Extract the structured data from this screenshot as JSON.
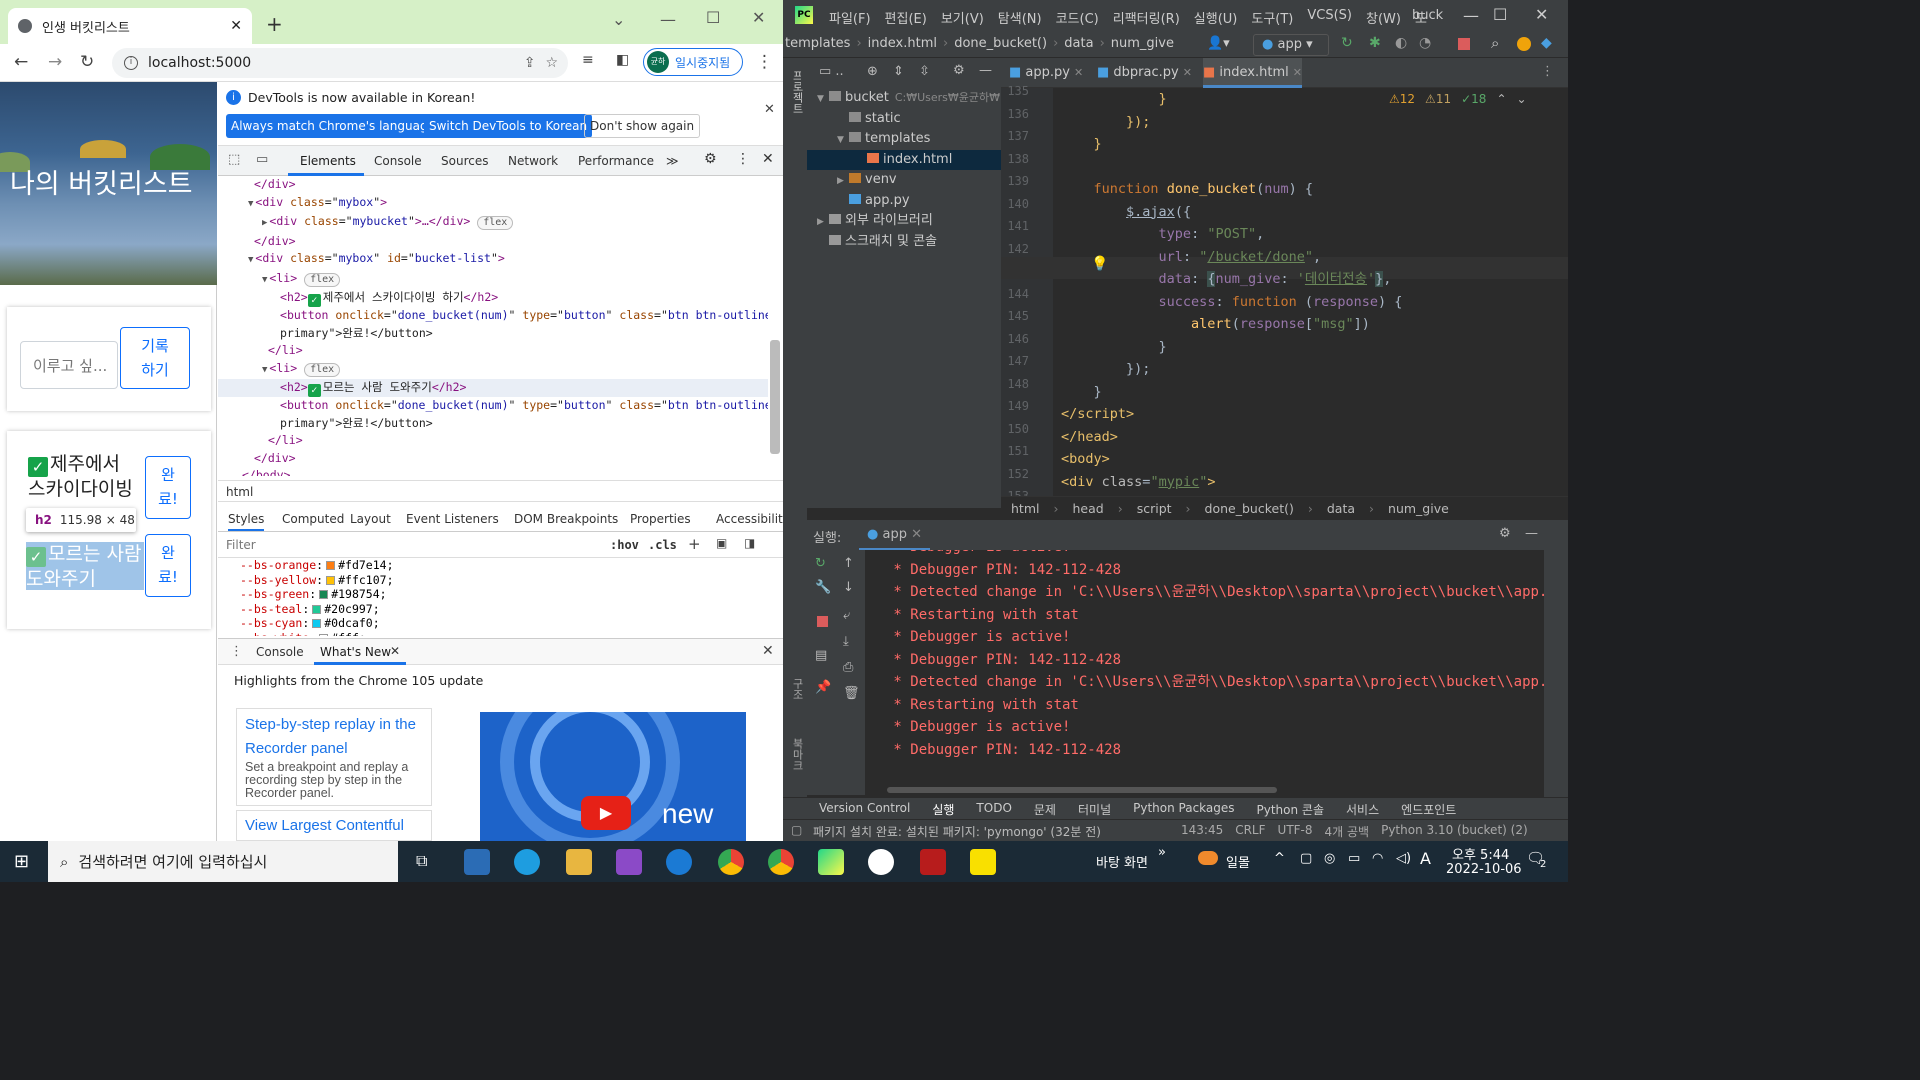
{
  "chrome": {
    "tab_title": "인생 버킷리스트",
    "url": "localhost:5000",
    "profile_initial": "균하",
    "profile_status": "일시중지됨"
  },
  "page": {
    "title": "나의 버킷리스트",
    "input_placeholder": "이루고 싶...",
    "record_button": "기록하기",
    "items": [
      {
        "text": "제주에서 스카이다이빙",
        "button": "완료!"
      },
      {
        "text": "모르는 사람 도와주기",
        "button": "완료!"
      }
    ],
    "tooltip_tag": "h2",
    "tooltip_size": "115.98 × 48"
  },
  "devtools": {
    "notice": "DevTools is now available in Korean!",
    "btn_match": "Always match Chrome's language",
    "btn_switch": "Switch DevTools to Korean",
    "btn_dont": "Don't show again",
    "tabs": [
      "Elements",
      "Console",
      "Sources",
      "Network",
      "Performance"
    ],
    "dom_lines": [
      {
        "indent": 36,
        "html": "</div>"
      },
      {
        "indent": 30,
        "arrow": "▼",
        "tag": "div",
        "attrs": [
          [
            "class",
            "mybox"
          ]
        ]
      },
      {
        "indent": 44,
        "arrow": "▶",
        "tag": "div",
        "attrs": [
          [
            "class",
            "mybucket"
          ]
        ],
        "tail": "…</div>",
        "flex": true
      },
      {
        "indent": 36,
        "html": "</div>"
      },
      {
        "indent": 30,
        "arrow": "▼",
        "tag": "div",
        "attrs": [
          [
            "class",
            "mybox"
          ],
          [
            "id",
            "bucket-list"
          ]
        ]
      },
      {
        "indent": 44,
        "arrow": "▼",
        "tag": "li",
        "attrs": [],
        "flex": true
      },
      {
        "indent": 62,
        "tag": "h2",
        "attrs": [],
        "text": "제주에서 스카이다이빙 하기",
        "check": true,
        "close": "h2"
      },
      {
        "indent": 62,
        "tag": "button",
        "attrs": [
          [
            "onclick",
            "done_bucket(num)"
          ],
          [
            "type",
            "button"
          ],
          [
            "class",
            "btn btn-outline-"
          ]
        ]
      },
      {
        "indent": 62,
        "html": "primary\">완료!</button>",
        "continuation": true
      },
      {
        "indent": 50,
        "html": "</li>"
      },
      {
        "indent": 44,
        "arrow": "▼",
        "tag": "li",
        "attrs": [],
        "flex": true
      },
      {
        "indent": 62,
        "tag": "h2",
        "attrs": [],
        "text": "모르는 사람 도와주기",
        "check": true,
        "close": "h2",
        "selected": true
      },
      {
        "indent": 62,
        "tag": "button",
        "attrs": [
          [
            "onclick",
            "done_bucket(num)"
          ],
          [
            "type",
            "button"
          ],
          [
            "class",
            "btn btn-outline-"
          ]
        ]
      },
      {
        "indent": 62,
        "html": "primary\">완료!</button>",
        "continuation": true
      },
      {
        "indent": 50,
        "html": "</li>"
      },
      {
        "indent": 36,
        "html": "</div>"
      },
      {
        "indent": 24,
        "html": "</body>"
      },
      {
        "indent": 12,
        "html": "</html>"
      }
    ],
    "crumb": "html",
    "style_tabs": [
      "Styles",
      "Computed",
      "Layout",
      "Event Listeners",
      "DOM Breakpoints",
      "Properties",
      "Accessibility"
    ],
    "filter_placeholder": "Filter",
    "hov": ":hov",
    "cls": ".cls",
    "vars": [
      {
        "name": "--bs-orange",
        "value": "#fd7e14",
        "color": "#fd7e14"
      },
      {
        "name": "--bs-yellow",
        "value": "#ffc107",
        "color": "#ffc107"
      },
      {
        "name": "--bs-green",
        "value": "#198754",
        "color": "#198754"
      },
      {
        "name": "--bs-teal",
        "value": "#20c997",
        "color": "#20c997"
      },
      {
        "name": "--bs-cyan",
        "value": "#0dcaf0",
        "color": "#0dcaf0"
      },
      {
        "name": "--bs-white",
        "value": "#fff",
        "color": "#ffffff"
      }
    ],
    "drawer_tabs": [
      "Console",
      "What's New"
    ],
    "highlights": "Highlights from the Chrome 105 update",
    "card1_title": "Step-by-step replay in the Recorder panel",
    "card1_body": "Set a breakpoint and replay a recording step by step in the Recorder panel.",
    "card2_title": "View Largest Contentful",
    "yt_label": "new"
  },
  "pycharm": {
    "menu": [
      "파일(F)",
      "편집(E)",
      "보기(V)",
      "탐색(N)",
      "코드(C)",
      "리팩터링(R)",
      "실행(U)",
      "도구(T)",
      "VCS(S)",
      "창(W)",
      "도"
    ],
    "project_name": "buck",
    "breadcrumb": [
      "templates",
      "index.html",
      "done_bucket()",
      "data",
      "num_give"
    ],
    "run_config": "app",
    "tree": [
      {
        "label": "bucket",
        "extra": "C:₩Users₩윤균하₩",
        "indent": 10,
        "arrow": "▼",
        "kind": "folder"
      },
      {
        "label": "static",
        "indent": 30,
        "kind": "folder"
      },
      {
        "label": "templates",
        "indent": 30,
        "arrow": "▼",
        "kind": "folder"
      },
      {
        "label": "index.html",
        "indent": 48,
        "kind": "html",
        "selected": true
      },
      {
        "label": "venv",
        "indent": 30,
        "arrow": "▶",
        "kind": "folder-orange"
      },
      {
        "label": "app.py",
        "indent": 30,
        "kind": "py"
      },
      {
        "label": "외부 라이브러리",
        "indent": 10,
        "arrow": "▶",
        "kind": "lib"
      },
      {
        "label": "스크래치 및 콘솔",
        "indent": 10,
        "kind": "scratch"
      }
    ],
    "editor_tabs": [
      "app.py",
      "dbprac.py",
      "index.html"
    ],
    "inspections": {
      "warn1": "12",
      "warn2": "11",
      "ok": "18"
    },
    "line_numbers": [
      "135",
      "136",
      "137",
      "138",
      "139",
      "140",
      "141",
      "142",
      "143",
      "144",
      "145",
      "146",
      "147",
      "148",
      "149",
      "150",
      "151",
      "152",
      "153"
    ],
    "code_breadcrumb": [
      "html",
      "head",
      "script",
      "done_bucket()",
      "data",
      "num_give"
    ],
    "run_label": "실행:",
    "run_tab": "app",
    "console_lines": [
      " * Debugger is active!",
      " * Debugger PIN: 142-112-428",
      " * Detected change in 'C:\\\\Users\\\\윤균하\\\\Desktop\\\\sparta\\\\project\\\\bucket\\\\app.py'",
      " * Restarting with stat",
      " * Debugger is active!",
      " * Debugger PIN: 142-112-428",
      " * Detected change in 'C:\\\\Users\\\\윤균하\\\\Desktop\\\\sparta\\\\project\\\\bucket\\\\app.py'",
      " * Restarting with stat",
      " * Debugger is active!",
      " * Debugger PIN: 142-112-428"
    ],
    "bottom_tabs": [
      "Version Control",
      "실행",
      "TODO",
      "문제",
      "터미널",
      "Python Packages",
      "Python 콘솔",
      "서비스",
      "엔드포인트"
    ],
    "status_message": "패키지 설치 완료: 설치된 패키지: 'pymongo' (32분 전)",
    "status_right": [
      "143:45",
      "CRLF",
      "UTF-8",
      "4개 공백",
      "Python 3.10 (bucket) (2)"
    ]
  },
  "taskbar": {
    "search_placeholder": "검색하려면 여기에 입력하십시",
    "desktop_label": "바탕 화면",
    "weather": "일몰",
    "ime": "A",
    "time": "오후 5:44",
    "date": "2022-10-06",
    "notif_count": "2"
  }
}
